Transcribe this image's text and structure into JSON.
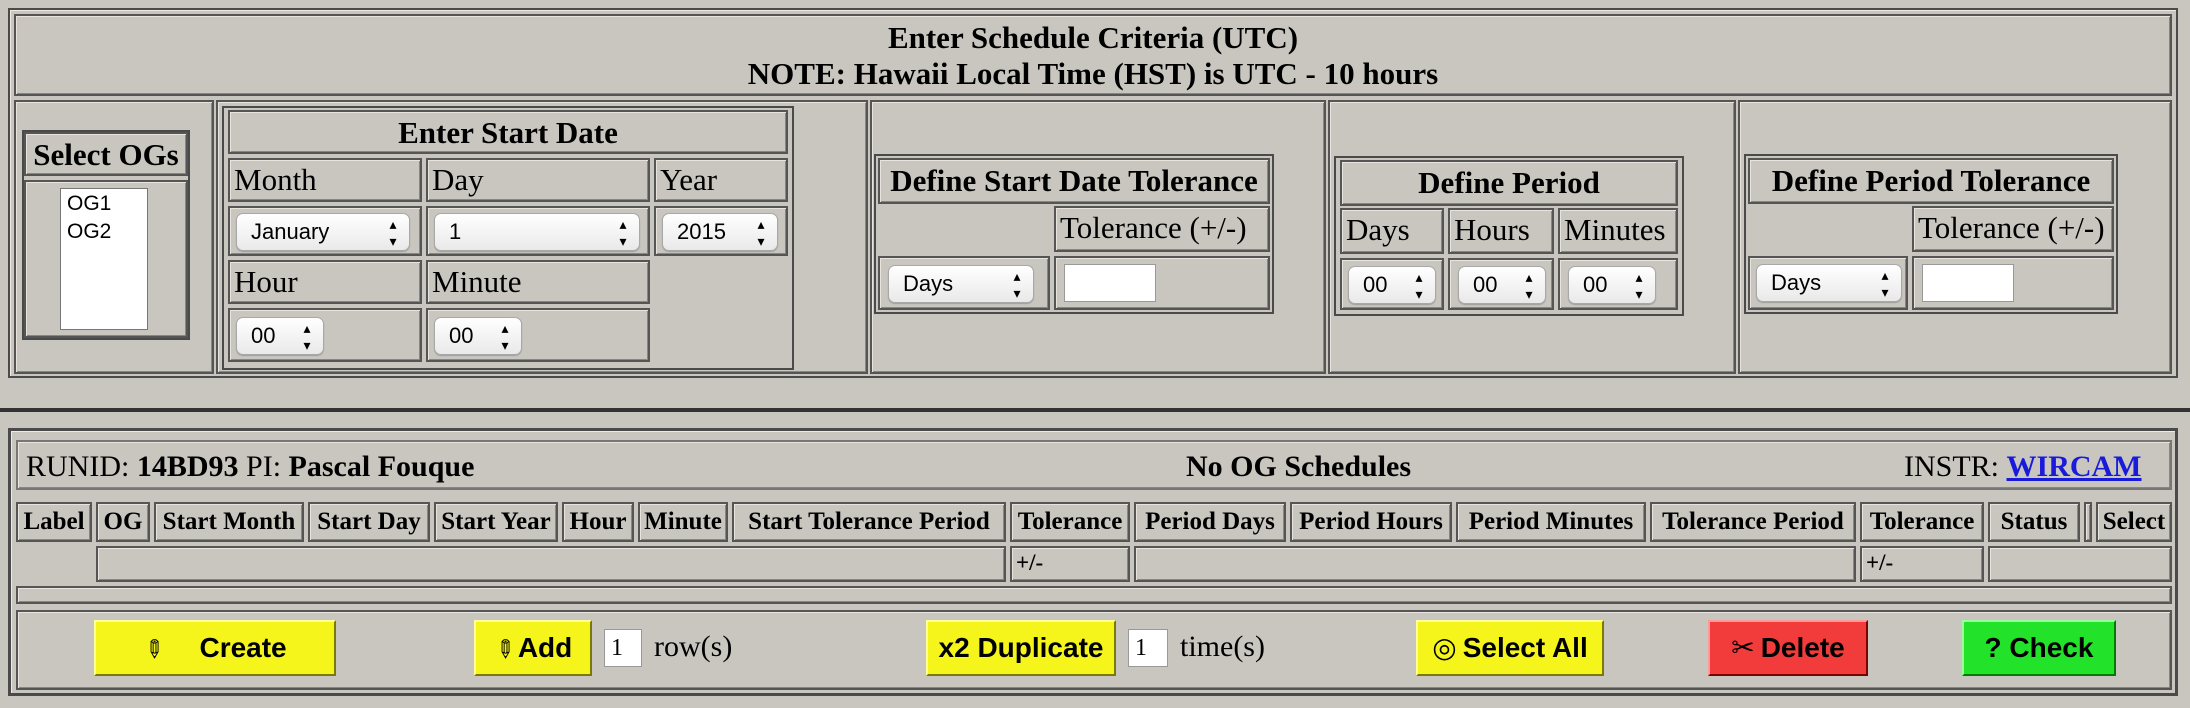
{
  "criteria": {
    "title": "Enter Schedule Criteria (UTC)",
    "note": "NOTE: Hawaii Local Time (HST) is UTC - 10 hours"
  },
  "select_ogs": {
    "title": "Select OGs",
    "options": [
      "OG1",
      "OG2"
    ]
  },
  "start_date": {
    "title": "Enter Start Date",
    "month_label": "Month",
    "day_label": "Day",
    "year_label": "Year",
    "hour_label": "Hour",
    "minute_label": "Minute",
    "month_value": "January",
    "day_value": "1",
    "year_value": "2015",
    "hour_value": "00",
    "minute_value": "00"
  },
  "start_tolerance": {
    "title": "Define Start Date Tolerance",
    "tolerance_label": "Tolerance (+/-)",
    "unit_value": "Days",
    "tolerance_value": ""
  },
  "period": {
    "title": "Define Period",
    "days_label": "Days",
    "hours_label": "Hours",
    "minutes_label": "Minutes",
    "days_value": "00",
    "hours_value": "00",
    "minutes_value": "00"
  },
  "period_tolerance": {
    "title": "Define Period Tolerance",
    "tolerance_label": "Tolerance (+/-)",
    "unit_value": "Days",
    "tolerance_value": ""
  },
  "run": {
    "runid_label": "RUNID:",
    "runid_value": "14BD93",
    "pi_label": "PI:",
    "pi_value": "Pascal Fouque",
    "status_text": "No OG Schedules",
    "instr_label": "INSTR:",
    "instr_value": "WIRCAM"
  },
  "table": {
    "headers": [
      "Label",
      "OG",
      "Start Month",
      "Start Day",
      "Start Year",
      "Hour",
      "Minute",
      "Start Tolerance Period",
      "Tolerance",
      "Period Days",
      "Period Hours",
      "Period Minutes",
      "Tolerance Period",
      "Tolerance",
      "Status",
      "",
      "Select"
    ],
    "row_tolerance_1": "+/-",
    "row_tolerance_2": "+/-"
  },
  "actions": {
    "create_label": "Create",
    "add_label": "Add",
    "add_rows_value": "1",
    "rows_suffix": "row(s)",
    "duplicate_label": "x2 Duplicate",
    "duplicate_times_value": "1",
    "times_suffix": "time(s)",
    "select_all_label": "Select All",
    "delete_label": "Delete",
    "check_label": "? Check"
  },
  "colors": {
    "background": "#c9c6c0",
    "yellow_button": "#f5f51c",
    "red_button": "#f23b3b",
    "green_button": "#22e22a",
    "link": "#1a1adb"
  }
}
